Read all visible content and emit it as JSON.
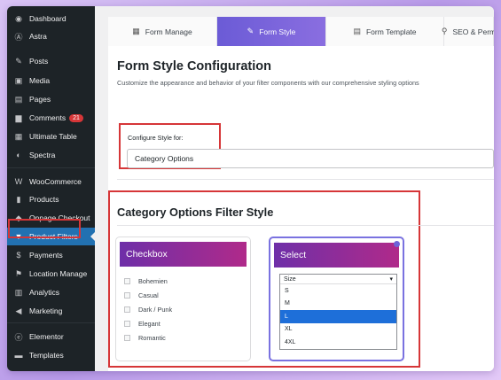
{
  "sidebar": {
    "items": [
      {
        "key": "dashboard",
        "label": "Dashboard",
        "icon": "dashboard-icon",
        "glyph": "◉"
      },
      {
        "key": "astra",
        "label": "Astra",
        "icon": "astra-icon",
        "glyph": "Ⓐ"
      },
      {
        "key": "posts",
        "label": "Posts",
        "icon": "pin-icon",
        "glyph": "✎"
      },
      {
        "key": "media",
        "label": "Media",
        "icon": "media-icon",
        "glyph": "▣"
      },
      {
        "key": "pages",
        "label": "Pages",
        "icon": "pages-icon",
        "glyph": "▤"
      },
      {
        "key": "comments",
        "label": "Comments",
        "icon": "comment-icon",
        "glyph": "▆",
        "badge": "21"
      },
      {
        "key": "ultimate-table",
        "label": "Ultimate Table",
        "icon": "table-icon",
        "glyph": "▦"
      },
      {
        "key": "spectra",
        "label": "Spectra",
        "icon": "spectra-icon",
        "glyph": "◐"
      },
      {
        "key": "woocommerce",
        "label": "WooCommerce",
        "icon": "woocommerce-icon",
        "glyph": "W"
      },
      {
        "key": "products",
        "label": "Products",
        "icon": "products-icon",
        "glyph": "▮"
      },
      {
        "key": "onpage-checkout",
        "label": "Onpage Checkout",
        "icon": "checkout-icon",
        "glyph": "◆"
      },
      {
        "key": "product-filters",
        "label": "Product Filters",
        "icon": "filter-icon",
        "glyph": "▼",
        "active": true
      },
      {
        "key": "payments",
        "label": "Payments",
        "icon": "payments-icon",
        "glyph": "$"
      },
      {
        "key": "location-manage",
        "label": "Location Manage",
        "icon": "location-icon",
        "glyph": "⚑"
      },
      {
        "key": "analytics",
        "label": "Analytics",
        "icon": "analytics-icon",
        "glyph": "▥"
      },
      {
        "key": "marketing",
        "label": "Marketing",
        "icon": "megaphone-icon",
        "glyph": "◀"
      },
      {
        "key": "elementor",
        "label": "Elementor",
        "icon": "elementor-icon",
        "glyph": "ⓔ"
      },
      {
        "key": "templates",
        "label": "Templates",
        "icon": "templates-icon",
        "glyph": "▬"
      }
    ]
  },
  "tabs": [
    {
      "label": "Form Manage",
      "icon": "form-manage-icon",
      "glyph": "▦"
    },
    {
      "label": "Form Style",
      "icon": "brush-icon",
      "glyph": "✎",
      "active": true
    },
    {
      "label": "Form Template",
      "icon": "template-icon",
      "glyph": "▤"
    },
    {
      "label": "SEO & Perm",
      "icon": "seo-icon",
      "glyph": "⚲"
    }
  ],
  "page": {
    "title": "Form Style Configuration",
    "subtitle": "Customize the appearance and behavior of your filter components with our comprehensive styling options",
    "configure_label": "Configure Style for:",
    "configure_value": "Category Options",
    "section_title": "Category Options Filter Style"
  },
  "cards": {
    "checkbox": {
      "title": "Checkbox",
      "options": [
        "Bohemien",
        "Casual",
        "Dark / Punk",
        "Elegant",
        "Romantic"
      ]
    },
    "select": {
      "title": "Select",
      "placeholder": "Size",
      "arrow": "▾",
      "options": [
        "S",
        "M",
        "L",
        "XL",
        "4XL"
      ],
      "highlighted": "L"
    }
  },
  "colors": {
    "accent": "#6b5bd6",
    "card_gradient_start": "#6e2fa8",
    "card_gradient_end": "#b02a8a",
    "highlight_red": "#d63638",
    "wp_active": "#2271b1"
  }
}
